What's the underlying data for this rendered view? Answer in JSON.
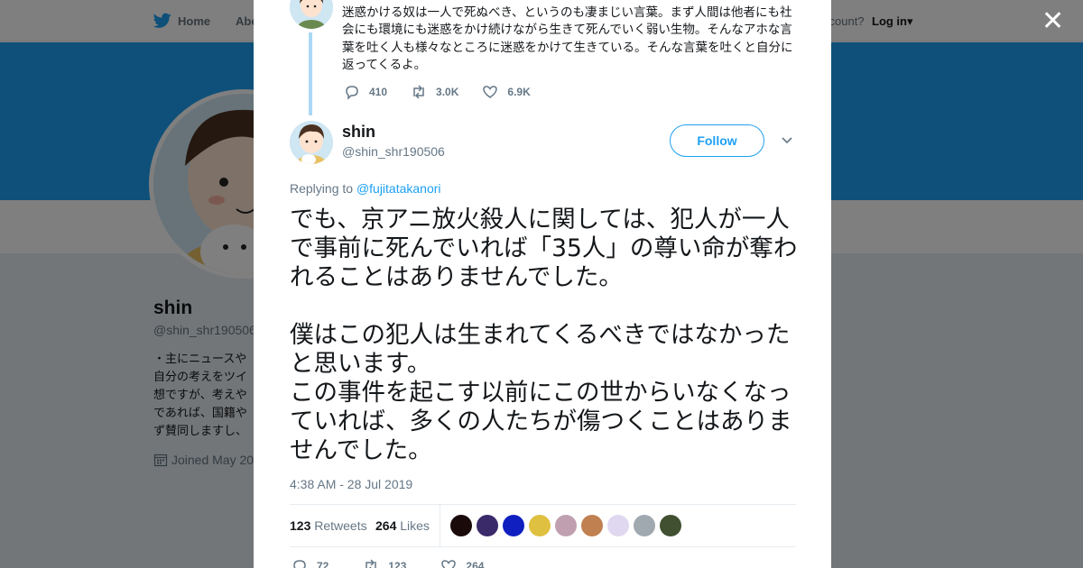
{
  "nav": {
    "home_label": "Home",
    "about_label": "Abo",
    "account_prompt": "ccount?",
    "login_label": "Log in"
  },
  "profile_bg": {
    "name": "shin",
    "handle": "@shin_shr190506",
    "bio_lines": [
      "・主にニュースや",
      "自分の考えをツイ",
      "想ですが、考えや",
      "であれば、国籍や",
      "ず賛同しますし、"
    ],
    "joined": "Joined May 20"
  },
  "prev_tweet": {
    "text": "迷惑かける奴は一人で死ぬべき、というのも凄まじい言葉。まず人間は他者にも社会にも環境にも迷惑をかけ続けながら生きて死んでいく弱い生物。そんなアホな言葉を吐く人も様々なところに迷惑をかけて生きている。そんな言葉を吐くと自分に返ってくるよ。",
    "replies": "410",
    "retweets": "3.0K",
    "likes": "6.9K"
  },
  "tweet": {
    "name": "shin",
    "handle": "@shin_shr190506",
    "follow_label": "Follow",
    "replying_prefix": "Replying to ",
    "replying_to": "@fujitatakanori",
    "text": "でも、京アニ放火殺人に関しては、犯人が一人で事前に死んでいれば「35人」の尊い命が奪われることはありませんでした。\n\n僕はこの犯人は生まれてくるべきではなかったと思います。\nこの事件を起こす以前にこの世からいなくなっていれば、多くの人たちが傷つくことはありませんでした。",
    "timestamp": "4:38 AM - 28 Jul 2019",
    "retweet_count": "123",
    "retweet_label": "Retweets",
    "like_count": "264",
    "like_label": "Likes",
    "actions": {
      "replies": "72",
      "retweets": "123",
      "likes": "264"
    }
  },
  "liker_colors": [
    "#1a0a0a",
    "#3a2a6a",
    "#1020c0",
    "#e0c040",
    "#c0a0b0",
    "#c08050",
    "#e0d8f0",
    "#a0a8b0",
    "#405030"
  ],
  "colors": {
    "accent": "#1da1f2",
    "banner": "#1da1f2"
  }
}
